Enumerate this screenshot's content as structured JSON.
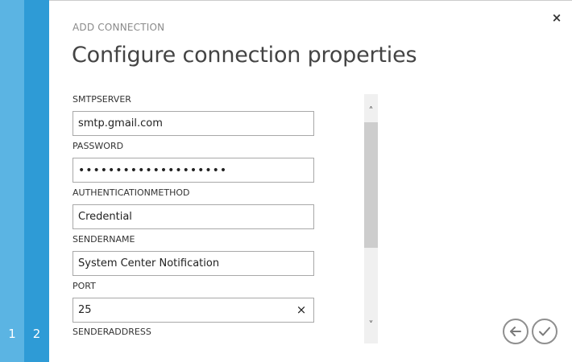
{
  "wizard": {
    "eyebrow": "ADD CONNECTION",
    "title": "Configure connection properties",
    "steps": [
      "1",
      "2"
    ],
    "current_step": 2,
    "close_glyph": "×"
  },
  "fields": [
    {
      "label": "SMTPSERVER",
      "value": "smtp.gmail.com"
    },
    {
      "label": "PASSWORD",
      "value": "••••••••••••••••••••"
    },
    {
      "label": "AUTHENTICATIONMETHOD",
      "value": "Credential"
    },
    {
      "label": "SENDERNAME",
      "value": "System Center Notification"
    },
    {
      "label": "PORT",
      "value": "25",
      "clear_glyph": "×"
    },
    {
      "label": "SENDERADDRESS",
      "value": ""
    }
  ],
  "scrollbar": {
    "up_glyph": "˄",
    "down_glyph": "˅"
  },
  "icons": {
    "close": "close-icon",
    "back": "arrow-left-icon",
    "finish": "checkmark-icon"
  },
  "colors": {
    "step_inactive": "#5bb4e3",
    "step_active": "#2e9bd6",
    "nav_border": "#8f8f8f"
  }
}
